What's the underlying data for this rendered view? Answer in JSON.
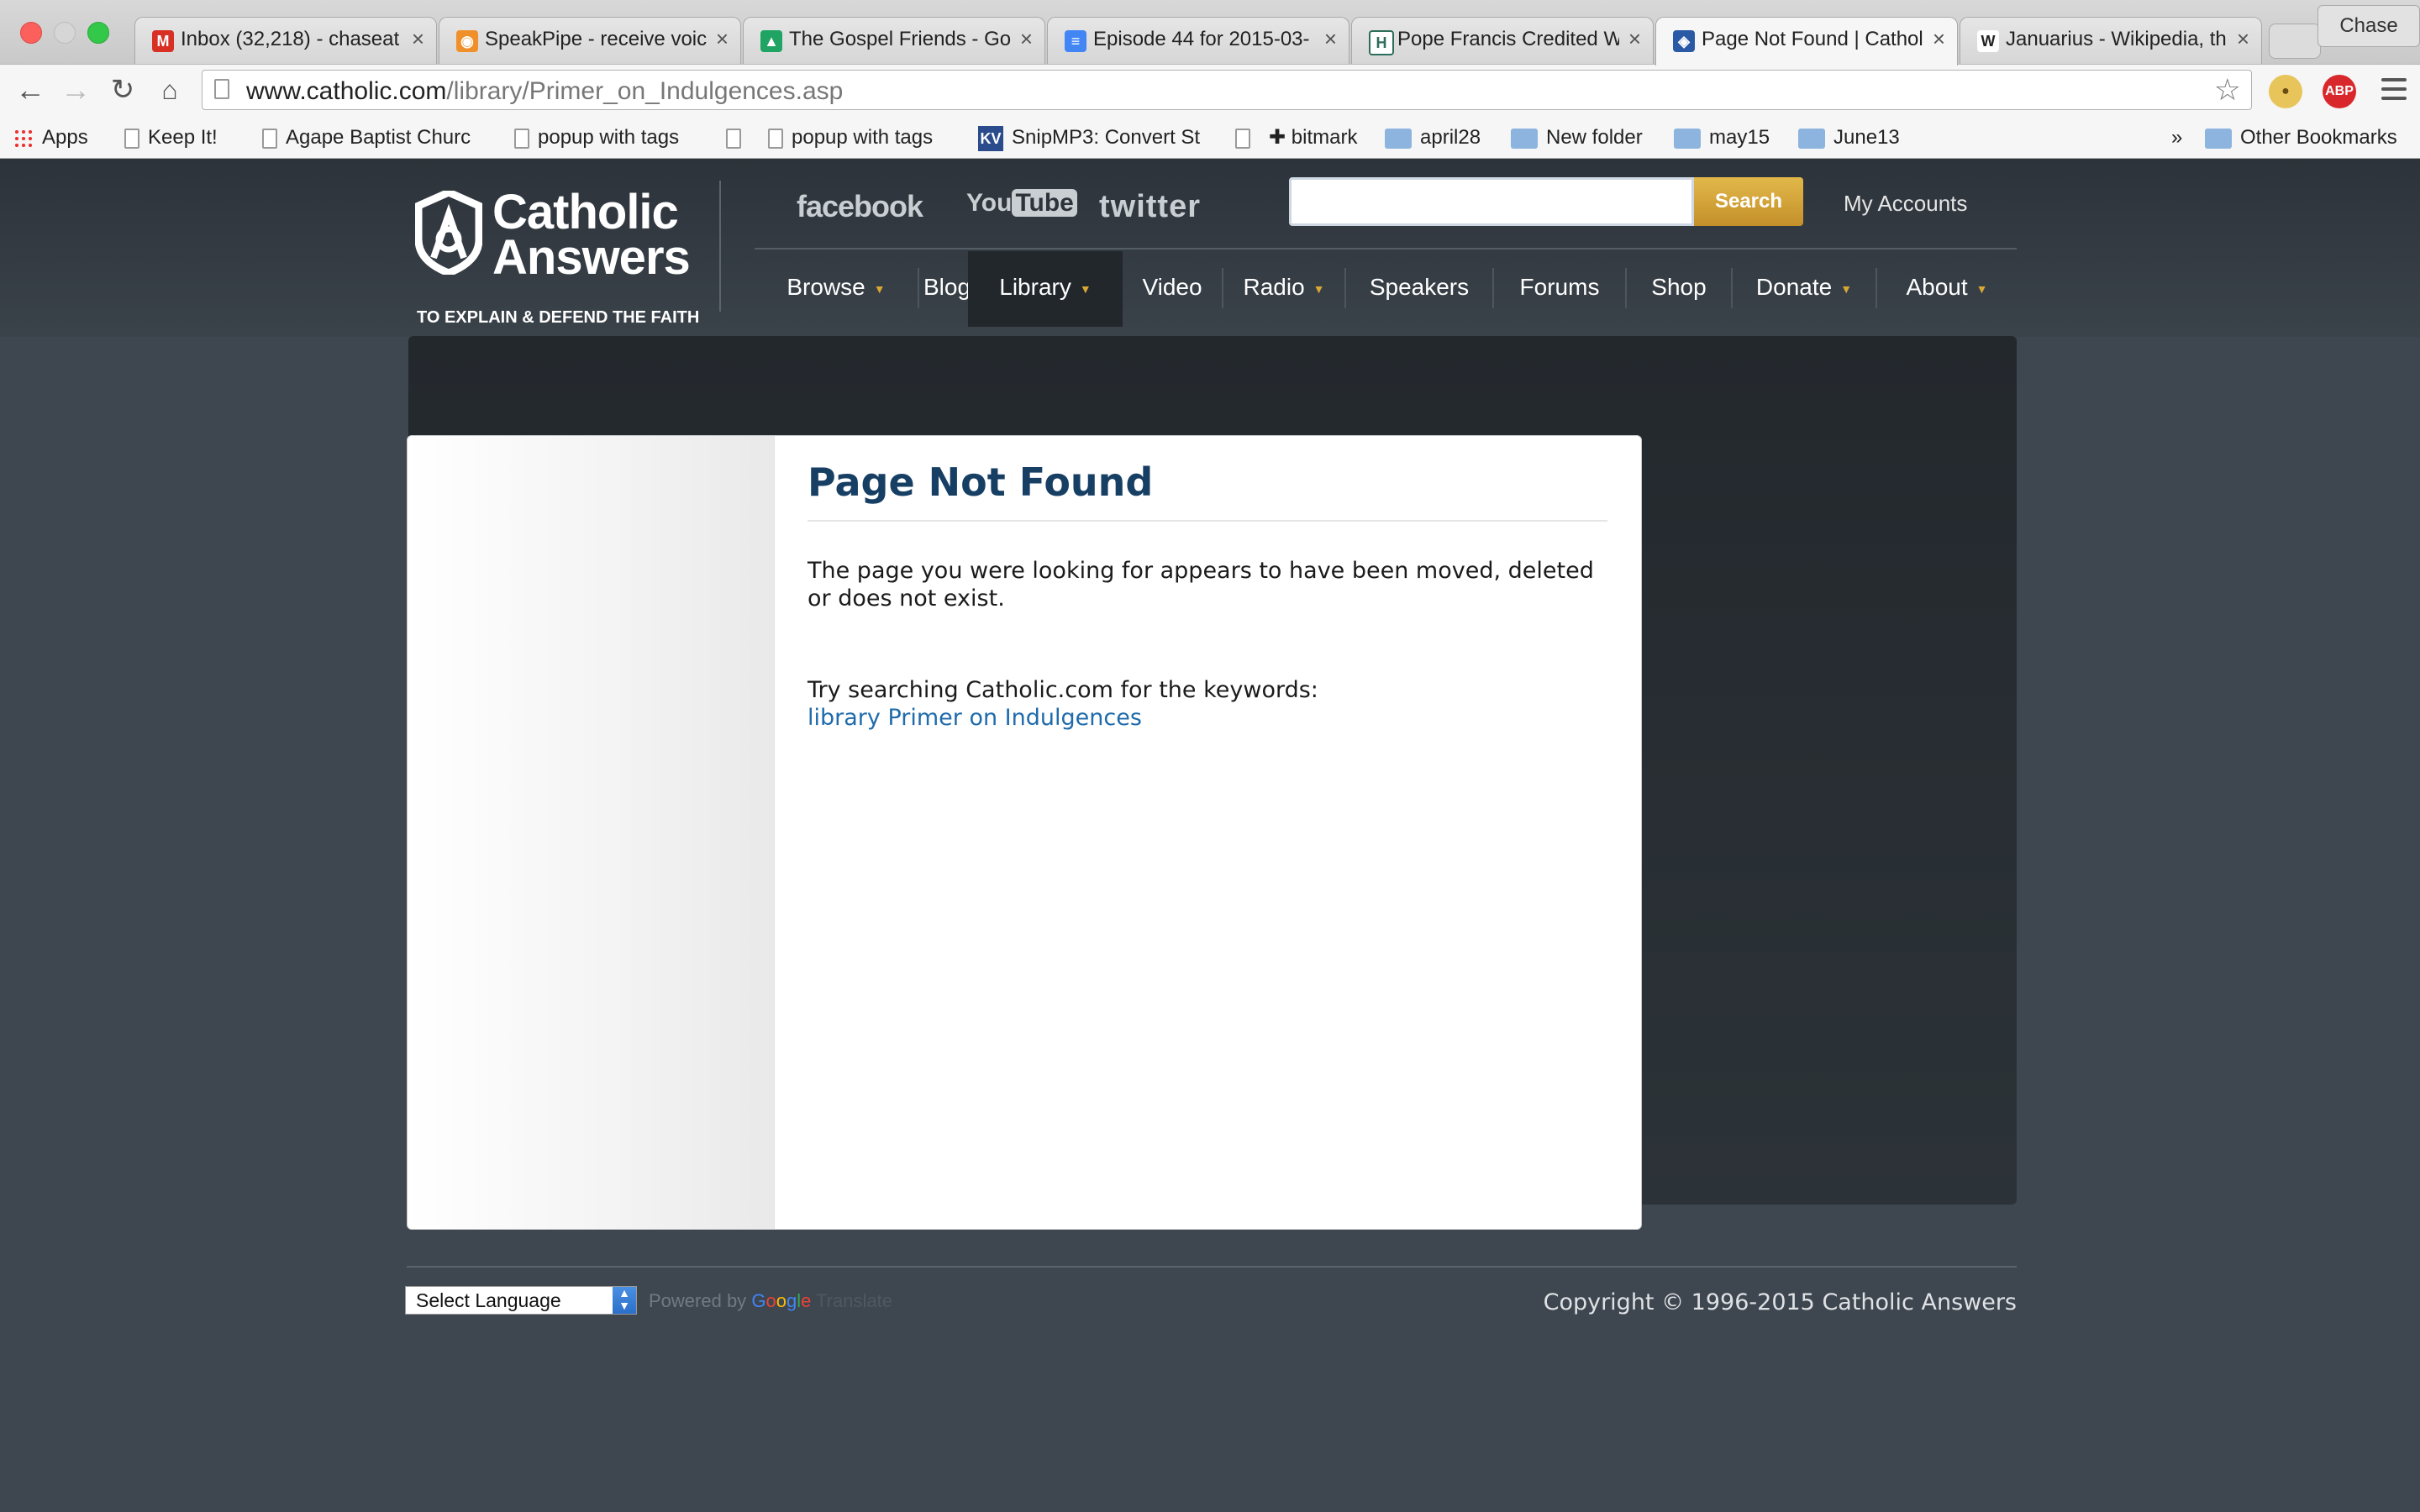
{
  "browser": {
    "tabs": [
      {
        "title": "Inbox (32,218) - chaseat",
        "favicon": "gmail-icon",
        "favicon_color": "#d93025"
      },
      {
        "title": "SpeakPipe - receive voic",
        "favicon": "speakpipe-icon",
        "favicon_color": "#f0902a"
      },
      {
        "title": "The Gospel Friends - Go",
        "favicon": "google-drive-icon",
        "favicon_color": "#1fa463"
      },
      {
        "title": "Episode 44 for 2015-03-",
        "favicon": "google-docs-icon",
        "favicon_color": "#4285f4"
      },
      {
        "title": "Pope Francis Credited W",
        "favicon": "h-icon",
        "favicon_color": "#2e6d5a"
      },
      {
        "title": "Page Not Found | Cathol",
        "favicon": "catholic-answers-icon",
        "favicon_color": "#2a5aa5",
        "active": true
      },
      {
        "title": "Januarius - Wikipedia, th",
        "favicon": "wikipedia-icon",
        "favicon_color": "#222222"
      }
    ],
    "tab_close_symbol": "×",
    "profile_name": "Chase",
    "url_domain": "www.catholic.com",
    "url_path": "/library/Primer_on_Indulgences.asp",
    "bookmarks": [
      {
        "label": "Apps",
        "icon": "apps-grid-icon"
      },
      {
        "label": "Keep It!",
        "icon": "page-icon"
      },
      {
        "label": "Agape Baptist Churc",
        "icon": "page-icon"
      },
      {
        "label": "popup with tags",
        "icon": "page-icon"
      },
      {
        "label": "",
        "icon": "page-icon"
      },
      {
        "label": "popup with tags",
        "icon": "page-icon"
      },
      {
        "label": "SnipMP3: Convert St",
        "icon": "kv-icon"
      },
      {
        "label": "",
        "icon": "page-icon"
      },
      {
        "label": "✚ bitmark",
        "icon": "none"
      },
      {
        "label": "april28",
        "icon": "folder-icon"
      },
      {
        "label": "New folder",
        "icon": "folder-icon"
      },
      {
        "label": "may15",
        "icon": "folder-icon"
      },
      {
        "label": "June13",
        "icon": "folder-icon"
      }
    ],
    "bookmarks_overflow": "»",
    "other_bookmarks": "Other Bookmarks"
  },
  "site": {
    "logo_line1": "Catholic",
    "logo_line2": "Answers",
    "tagline": "TO EXPLAIN & DEFEND THE FAITH",
    "social": {
      "facebook": "facebook",
      "youtube_you": "You",
      "youtube_tube": "Tube",
      "twitter": "twitter"
    },
    "search_placeholder": "",
    "search_button": "Search",
    "my_accounts": "My Accounts",
    "nav": [
      {
        "label": "Browse",
        "dropdown": true
      },
      {
        "label": "Blog",
        "dropdown": false
      },
      {
        "label": "Library",
        "dropdown": true,
        "active": true
      },
      {
        "label": "Video",
        "dropdown": false
      },
      {
        "label": "Radio",
        "dropdown": true
      },
      {
        "label": "Speakers",
        "dropdown": false
      },
      {
        "label": "Forums",
        "dropdown": false
      },
      {
        "label": "Shop",
        "dropdown": false
      },
      {
        "label": "Donate",
        "dropdown": true
      },
      {
        "label": "About",
        "dropdown": true
      }
    ],
    "page_title": "Page Not Found",
    "message": "The page you were looking for appears to have been moved, deleted or does not exist.",
    "try_text": "Try searching Catholic.com for the keywords:",
    "keywords_link": "library Primer on Indulgences",
    "language_select": "Select Language",
    "powered_by": "Powered by",
    "google": "Google",
    "translate": "Translate",
    "copyright": "Copyright © 1996-2015 Catholic Answers"
  },
  "colors": {
    "title_blue": "#173f64",
    "link_blue": "#1f6bab",
    "search_gold": "#d4a53a",
    "nav_caret": "#d9a733"
  }
}
